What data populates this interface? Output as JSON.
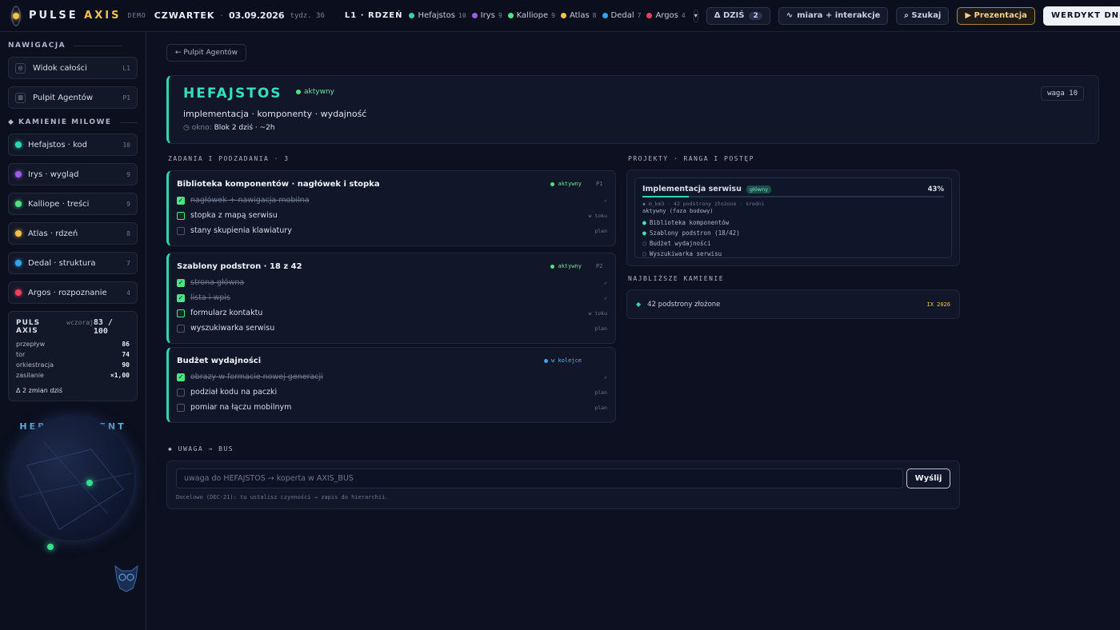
{
  "topbar": {
    "brand_a": "PULSE",
    "brand_b": "AXIS",
    "demo": "DEMO",
    "weekday": "CZWARTEK",
    "date": "03.09.2026",
    "week": "tydz. 36",
    "layer": "L1 · RDZEŃ",
    "agents": [
      {
        "name": "Hefajstos",
        "count": "10",
        "color": "#2ed6b6"
      },
      {
        "name": "Irys",
        "count": "9",
        "color": "#a05ae8"
      },
      {
        "name": "Kalliope",
        "count": "9",
        "color": "#4ee383"
      },
      {
        "name": "Atlas",
        "count": "8",
        "color": "#f4c14a"
      },
      {
        "name": "Dedal",
        "count": "7",
        "color": "#2fa6ee"
      },
      {
        "name": "Argos",
        "count": "4",
        "color": "#f03f5e"
      }
    ],
    "dropdown": "▾",
    "today_label": "Δ DZIŚ",
    "today_count": "2",
    "measure_label": "miara + interakcje",
    "search_label": "⌕ Szukaj",
    "presentation_label": "▶ Prezentacja",
    "verdict_label": "WERDYKT DNIA"
  },
  "sidebar": {
    "nav_title": "NAWIGACJA",
    "nav": [
      {
        "label": "Widok całości",
        "key": "L1",
        "icon": "◎"
      },
      {
        "label": "Pulpit Agentów",
        "key": "P1",
        "icon": "▥"
      }
    ],
    "milestones_title": "◆ KAMIENIE MILOWE",
    "milestones": [
      {
        "label": "Hefajstos · kod",
        "count": "10",
        "color": "#2ed6b6"
      },
      {
        "label": "Irys · wygląd",
        "count": "9",
        "color": "#a05ae8"
      },
      {
        "label": "Kalliope · treści",
        "count": "9",
        "color": "#4ee383"
      },
      {
        "label": "Atlas · rdzeń",
        "count": "8",
        "color": "#f4c14a"
      },
      {
        "label": "Dedal · struktura",
        "count": "7",
        "color": "#2fa6ee"
      },
      {
        "label": "Argos · rozpoznanie",
        "count": "4",
        "color": "#f03f5e"
      }
    ],
    "puls": {
      "title": "PULS AXIS",
      "when": "wczoraj",
      "score": "83 / 100",
      "rows": [
        {
          "label": "przepływ",
          "value": "86"
        },
        {
          "label": "tor",
          "value": "74"
        },
        {
          "label": "orkiestracja",
          "value": "90"
        },
        {
          "label": "zasilanie",
          "value": "×1,00"
        }
      ],
      "delta": "Δ 2 zmian dziś"
    },
    "hermes": "HERMES AGENT"
  },
  "main": {
    "back_label": "← Pulpit Agentów",
    "agent": {
      "name": "HEFAJSTOS",
      "status": "aktywny",
      "tags": "implementacja · komponenty · wydajność",
      "window_label": "◷ okno:",
      "window_value": "Blok 2 dziś · ~2h",
      "weight": "waga 10"
    },
    "tasks_title": "ZADANIA I PODZADANIA · 3",
    "tasks": [
      {
        "title": "Biblioteka komponentów · nagłówek i stopka",
        "status": "aktywny",
        "priority": "P1",
        "subtasks": [
          {
            "label": "nagłówek + nawigacja mobilna",
            "state": "✓",
            "kind": "done"
          },
          {
            "label": "stopka z mapą serwisu",
            "state": "w toku",
            "kind": "prog"
          },
          {
            "label": "stany skupienia klawiatury",
            "state": "plan",
            "kind": "plan"
          }
        ]
      },
      {
        "title": "Szablony podstron · 18 z 42",
        "status": "aktywny",
        "priority": "P2",
        "subtasks": [
          {
            "label": "strona główna",
            "state": "✓",
            "kind": "done"
          },
          {
            "label": "lista i wpis",
            "state": "✓",
            "kind": "done"
          },
          {
            "label": "formularz kontaktu",
            "state": "w toku",
            "kind": "prog"
          },
          {
            "label": "wyszukiwarka serwisu",
            "state": "plan",
            "kind": "plan"
          }
        ]
      },
      {
        "title": "Budżet wydajności",
        "status": "w kolejce",
        "priority": "",
        "subtasks": [
          {
            "label": "obrazy w formacie nowej generacji",
            "state": "✓",
            "kind": "done"
          },
          {
            "label": "podział kodu na paczki",
            "state": "plan",
            "kind": "plan"
          },
          {
            "label": "pomiar na łączu mobilnym",
            "state": "plan",
            "kind": "plan"
          }
        ]
      }
    ],
    "projects_title": "PROJEKTY · RANGA I POSTĘP",
    "project": {
      "name": "Implementacja serwisu",
      "tag": "główny",
      "percent": "43%",
      "progress": 0.43,
      "meta": "◆ m_km3 · 42 podstrony złożone · średni",
      "state": "aktywny (faza budowy)",
      "items": [
        {
          "label": "Biblioteka komponentów",
          "mark": "●",
          "active": true
        },
        {
          "label": "Szablony podstron (18/42)",
          "mark": "●",
          "active": true
        },
        {
          "label": "Budżet wydajności",
          "mark": "○",
          "active": false
        },
        {
          "label": "Wyszukiwarka serwisu",
          "mark": "○",
          "active": false
        }
      ]
    },
    "milestones_title": "NAJBLIŻSZE KAMIENIE",
    "next_milestone": {
      "mark": "◆",
      "label": "42 podstrony złożone",
      "date": "IX 2026"
    },
    "note_title": "◆ UWAGA → BUS",
    "note_placeholder": "uwaga do HEFAJSTOS → koperta w AXIS_BUS",
    "send_label": "Wyślij",
    "note_hint": "Docelowo (DEC-21): tu ustalisz czynności → zapis do hierarchii."
  }
}
